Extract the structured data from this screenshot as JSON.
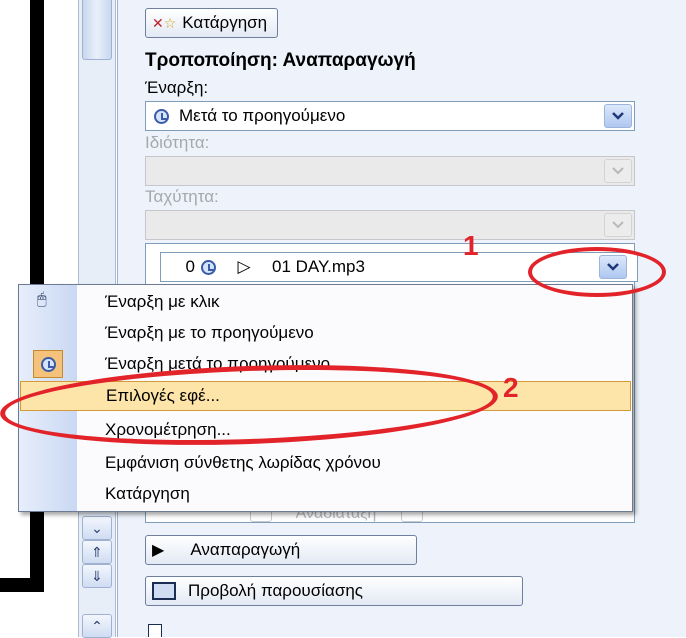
{
  "task_pane": {
    "remove_button": "Κατάργηση",
    "section_title": "Τροποποίηση: Αναπαραγωγή",
    "start_label": "Έναρξη:",
    "start_value": "Μετά το προηγούμενο",
    "property_label": "Ιδιότητα:",
    "speed_label": "Ταχύτητα:",
    "effect_item": {
      "order": "0",
      "name": "01 DAY.mp3"
    },
    "reorder_label": "Αναδιάταξη",
    "play_button": "Αναπαραγωγή",
    "slideshow_button": "Προβολή παρουσίασης"
  },
  "context_menu": {
    "items": [
      {
        "label": "Έναρξη με κλικ",
        "icon": "mouse-click-icon"
      },
      {
        "label": "Έναρξη με το προηγούμενο",
        "icon": ""
      },
      {
        "label": "Έναρξη μετά το προηγούμενο",
        "icon": "clock-icon",
        "checked": true
      },
      {
        "label": "Επιλογές εφέ...",
        "highlighted": true
      },
      {
        "label": "Χρονομέτρηση..."
      },
      {
        "label": "Εμφάνιση σύνθετης λωρίδας χρόνου"
      },
      {
        "label": "Κατάργηση"
      }
    ]
  },
  "annotations": {
    "marker_1": "1",
    "marker_2": "2",
    "color": "#e2242a"
  },
  "colors": {
    "menu_highlight": "#fde4a8",
    "pane_background": "#eef3fb"
  }
}
